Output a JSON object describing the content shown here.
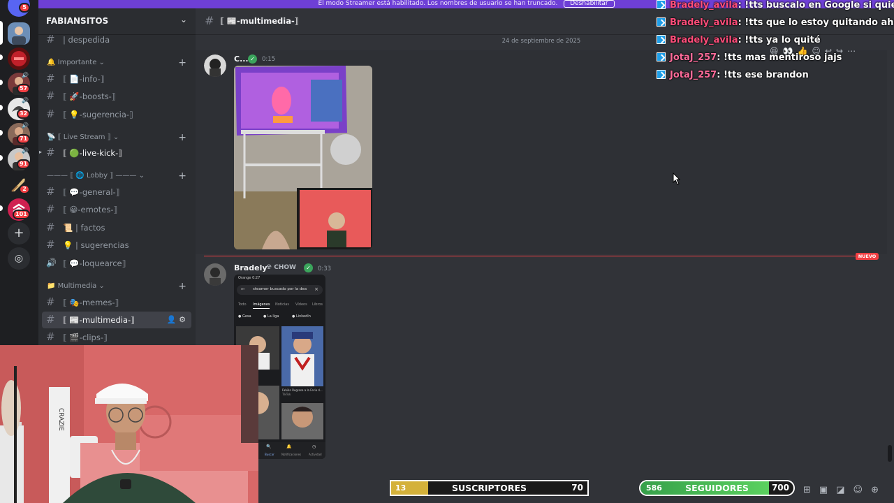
{
  "banner": {
    "text": "El modo Streamer está habilitado. Los nombres de usuario se han truncado.",
    "button": "Deshabilitar"
  },
  "rail": {
    "badges": [
      "5",
      "57",
      "32",
      "71",
      "91",
      "2",
      "101"
    ]
  },
  "guild": {
    "name": "FABIANSITOS"
  },
  "sidebar": {
    "channels": [
      {
        "emoji": "👋",
        "name": "| despedida"
      },
      {
        "emoji": "📄",
        "name": "⟦ 📄-info-⟧"
      },
      {
        "emoji": "🚀",
        "name": "⟦ 🚀-boosts-⟧"
      },
      {
        "emoji": "💡",
        "name": "⟦ 💡-sugerencia-⟧"
      },
      {
        "emoji": "🟢",
        "name": "⟦ 🟢-live-kick-⟧"
      },
      {
        "emoji": "💬",
        "name": "⟦ 💬-general-⟧"
      },
      {
        "emoji": "😀",
        "name": "⟦ 😀-emotes-⟧"
      },
      {
        "emoji": "📜",
        "name": "📜 | factos"
      },
      {
        "emoji": "💡",
        "name": "💡 | sugerencias"
      },
      {
        "emoji": "🔊",
        "name": "⟦ 💬-loquearce⟧"
      },
      {
        "emoji": "🎭",
        "name": "⟦ 🎭-memes-⟧"
      },
      {
        "emoji": "📰",
        "name": "⟦ 📰-multimedia-⟧"
      },
      {
        "emoji": "🎬",
        "name": "⟦ 🎬-clips-⟧"
      }
    ],
    "categories": {
      "importante": "Importante",
      "live": "⟦ Live Stream ⟧",
      "lobby": "⟦ 🌐 Lobby ⟧",
      "multimedia": "Multimedia"
    }
  },
  "channel": {
    "title": "⟦ 📰-multimedia-⟧"
  },
  "messages": {
    "date": "24 de septiembre de 2025",
    "first": {
      "user": "C...",
      "time": "0:15"
    },
    "second": {
      "user": "Bradely",
      "tag": "CHOW",
      "time": "0:33"
    },
    "new_label": "NUEVO",
    "phone": {
      "status": "Orange 0:27",
      "search": "steamer buscado por la dea",
      "tabs": [
        "Todo",
        "Imágenes",
        "Noticias",
        "Vídeos",
        "Libros"
      ],
      "chips": [
        "Gesa",
        "La liga",
        "LinkedIn"
      ],
      "captions": [
        "Real Madrid",
        "Fabián Regresa a la Feria d...",
        "TikTok",
        "LIVE Event"
      ],
      "nav": [
        "Buscar",
        "Notificaciones",
        "Actividad"
      ]
    }
  },
  "chat": [
    {
      "user": "Bradely_avila",
      "text": ": !tts buscalo en Google si quieres"
    },
    {
      "user": "Bradely_avila",
      "text": ": !tts que lo estoy quitando ahora"
    },
    {
      "user": "Bradely_avila",
      "text": ": !tts ya lo quité"
    },
    {
      "user": "JotaJ_257",
      "text": ": !tts mas mentiroso jajs"
    },
    {
      "user": "JotaJ_257",
      "text": ": !tts ese brandon"
    }
  ],
  "goals": {
    "subs": {
      "current": "13",
      "label": "SUSCRIPTORES",
      "target": "70",
      "progress": 0.19
    },
    "followers": {
      "current": "586",
      "label": "SEGUIDORES",
      "target": "700",
      "progress": 0.84
    }
  },
  "colors": {
    "accent": "#6e3fd6",
    "new": "#f23f43",
    "chat_user": "#ff4d7a"
  }
}
